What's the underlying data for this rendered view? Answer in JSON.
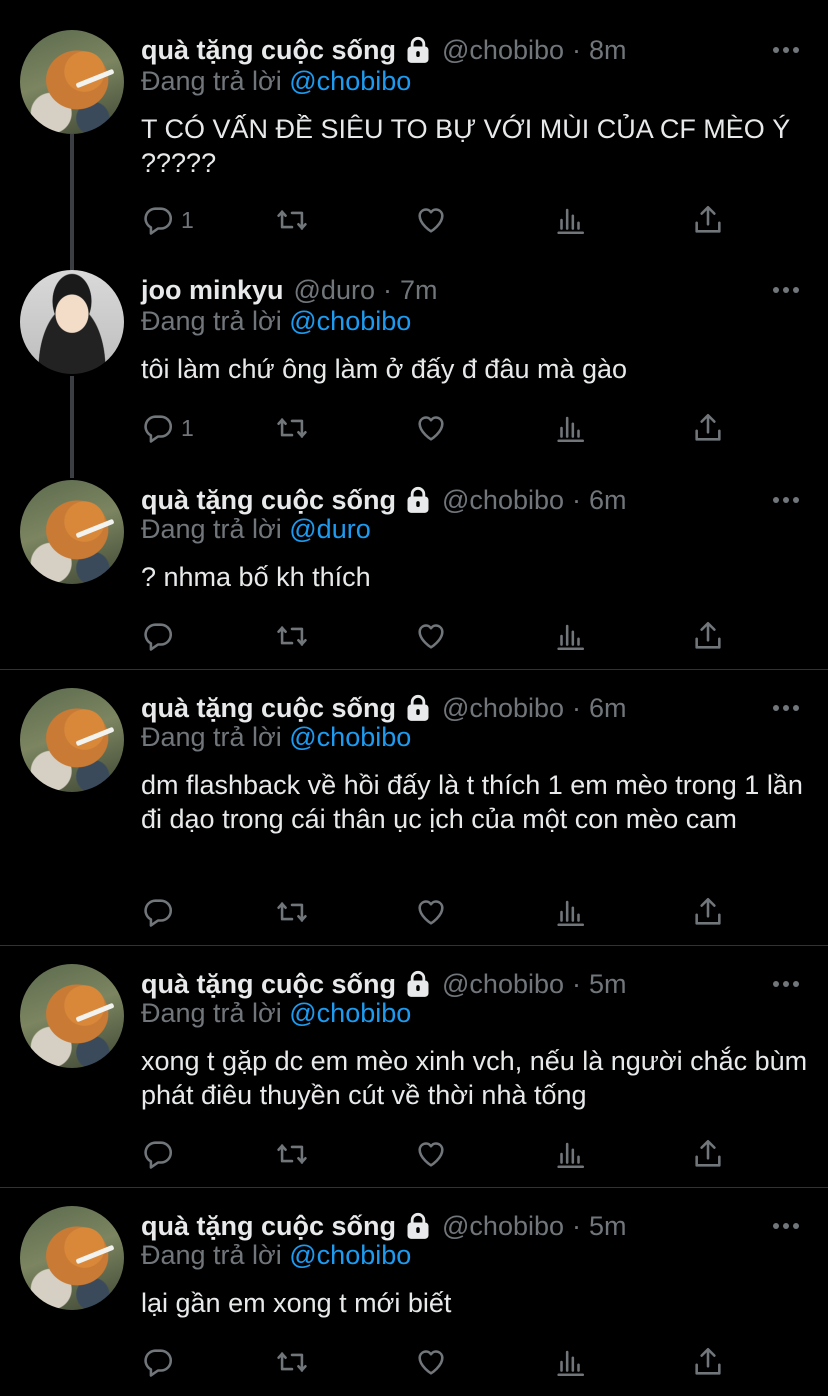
{
  "tweets": [
    {
      "name": "quà tặng cuộc sống",
      "locked": true,
      "handle": "@chobibo",
      "time": "8m",
      "reply_prefix": "Đang trả lời ",
      "reply_to": "@chobibo",
      "text": "T CÓ VẤN ĐỀ SIÊU TO BỰ VỚI MÙI CỦA CF MÈO Ý ?????",
      "reply_count": "1",
      "avatar": "cat-avatar"
    },
    {
      "name": "joo minkyu",
      "locked": false,
      "handle": "@duro",
      "time": "7m",
      "reply_prefix": "Đang trả lời ",
      "reply_to": "@chobibo",
      "text": "tôi làm chứ ông làm ở đấy đ đâu mà gào",
      "reply_count": "1",
      "avatar": "person-avatar"
    },
    {
      "name": "quà tặng cuộc sống",
      "locked": true,
      "handle": "@chobibo",
      "time": "6m",
      "reply_prefix": "Đang trả lời ",
      "reply_to": "@duro",
      "text": "? nhma bố kh thích",
      "reply_count": "",
      "avatar": "cat-avatar"
    },
    {
      "name": "quà tặng cuộc sống",
      "locked": true,
      "handle": "@chobibo",
      "time": "6m",
      "reply_prefix": "Đang trả lời ",
      "reply_to": "@chobibo",
      "text": "dm flashback về hồi đấy là t thích 1 em mèo trong 1 lần đi dạo trong cái thân ục ịch của một con mèo cam",
      "reply_count": "",
      "avatar": "cat-avatar"
    },
    {
      "name": "quà tặng cuộc sống",
      "locked": true,
      "handle": "@chobibo",
      "time": "5m",
      "reply_prefix": "Đang trả lời ",
      "reply_to": "@chobibo",
      "text": "xong t gặp dc em mèo xinh vch, nếu là người chắc bùm phát điêu thuyền cút về thời nhà tống",
      "reply_count": "",
      "avatar": "cat-avatar"
    },
    {
      "name": "quà tặng cuộc sống",
      "locked": true,
      "handle": "@chobibo",
      "time": "5m",
      "reply_prefix": "Đang trả lời ",
      "reply_to": "@chobibo",
      "text": "lại gần em xong t mới biết",
      "reply_count": "",
      "avatar": "cat-avatar"
    }
  ],
  "colors": {
    "background": "#000000",
    "text": "#e7e9ea",
    "muted": "#71767b",
    "mention": "#1d9bf0",
    "separator": "#2f3336"
  },
  "icons": [
    "reply-icon",
    "retweet-icon",
    "like-icon",
    "analytics-icon",
    "share-icon",
    "more-icon",
    "lock-icon"
  ]
}
